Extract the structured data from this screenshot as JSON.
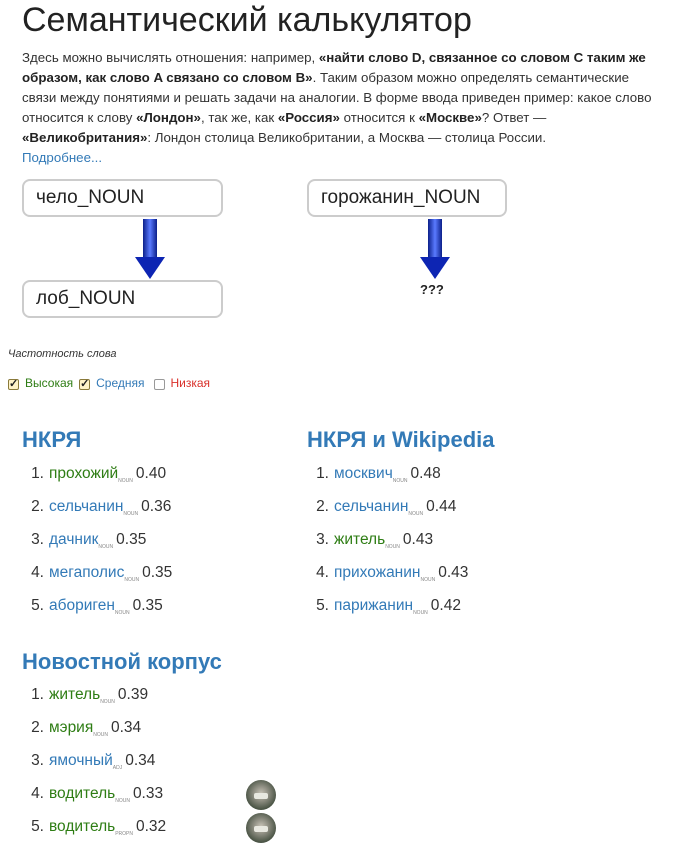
{
  "page": {
    "title": "Семантический калькулятор"
  },
  "intro": {
    "p1": "Здесь можно вычислять отношения: например, ",
    "b1": "«найти слово D, связанное со словом C таким же образом, как слово A связано со словом B»",
    "p2": ". Таким образом можно определять семантические связи между понятиями и решать задачи на аналогии. В форме ввода приведен пример: какое слово относится к слову ",
    "b2": "«Лондон»",
    "p3": ", так же, как ",
    "b3": "«Россия»",
    "p4": " относится к ",
    "b4": "«Москве»",
    "p5": "? Ответ — ",
    "b5": "«Великобритания»",
    "p6": ": Лондон столица Великобритании, а Москва — столица России.",
    "more_link": "Подробнее..."
  },
  "inputs": {
    "word_a": "чело_NOUN",
    "word_b": "лоб_NOUN",
    "word_c": "горожанин_NOUN",
    "unknown": "???"
  },
  "frequency": {
    "title": "Частотность слова",
    "high": {
      "label": "Высокая",
      "checked": true
    },
    "medium": {
      "label": "Средняя",
      "checked": true
    },
    "low": {
      "label": "Низкая",
      "checked": false
    }
  },
  "colors": {
    "high": "#2e7d14",
    "medium": "#337ab7",
    "low": "#d9302a",
    "arrow": "#1f3fbf"
  },
  "sections": {
    "nkrya": {
      "title": "НКРЯ",
      "items": [
        {
          "n": "1.",
          "word": "прохожий",
          "pos": "NOUN",
          "score": "0.40",
          "freq": "high"
        },
        {
          "n": "2.",
          "word": "сельчанин",
          "pos": "NOUN",
          "score": "0.36",
          "freq": "medium"
        },
        {
          "n": "3.",
          "word": "дачник",
          "pos": "NOUN",
          "score": "0.35",
          "freq": "medium"
        },
        {
          "n": "4.",
          "word": "мегаполис",
          "pos": "NOUN",
          "score": "0.35",
          "freq": "medium"
        },
        {
          "n": "5.",
          "word": "абориген",
          "pos": "NOUN",
          "score": "0.35",
          "freq": "medium"
        }
      ]
    },
    "wiki": {
      "title": "НКРЯ и Wikipedia",
      "items": [
        {
          "n": "1.",
          "word": "москвич",
          "pos": "NOUN",
          "score": "0.48",
          "freq": "medium"
        },
        {
          "n": "2.",
          "word": "сельчанин",
          "pos": "NOUN",
          "score": "0.44",
          "freq": "medium"
        },
        {
          "n": "3.",
          "word": "житель",
          "pos": "NOUN",
          "score": "0.43",
          "freq": "high"
        },
        {
          "n": "4.",
          "word": "прихожанин",
          "pos": "NOUN",
          "score": "0.43",
          "freq": "medium"
        },
        {
          "n": "5.",
          "word": "парижанин",
          "pos": "NOUN",
          "score": "0.42",
          "freq": "medium"
        }
      ]
    },
    "news": {
      "title": "Новостной корпус",
      "items": [
        {
          "n": "1.",
          "word": "житель",
          "pos": "NOUN",
          "score": "0.39",
          "freq": "high"
        },
        {
          "n": "2.",
          "word": "мэрия",
          "pos": "NOUN",
          "score": "0.34",
          "freq": "high"
        },
        {
          "n": "3.",
          "word": "ямочный",
          "pos": "ADJ",
          "score": "0.34",
          "freq": "medium"
        },
        {
          "n": "4.",
          "word": "водитель",
          "pos": "NOUN",
          "score": "0.33",
          "freq": "high",
          "avatar": true
        },
        {
          "n": "5.",
          "word": "водитель",
          "pos": "PROPN",
          "score": "0.32",
          "freq": "high",
          "avatar": true
        }
      ]
    }
  }
}
